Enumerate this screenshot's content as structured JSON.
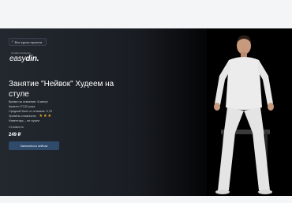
{
  "header": {
    "back_label": "Все курсы проекта"
  },
  "logo": {
    "pretitle": "Онлайн-платформа",
    "part1": "easy",
    "part2": "din."
  },
  "course": {
    "title": "Занятие \"Нейвок\" Худеем на стуле",
    "details": [
      "Время на освоение: 8 минут",
      "Купили 17132 раза",
      "Средний балл от отзывов: 9,78",
      "Уровень сложности:",
      "Инвентарь – не нужен"
    ],
    "difficulty_stars": 3
  },
  "pricing": {
    "label": "Стоимость",
    "price": "249 ₽"
  },
  "actions": {
    "enroll_label": "Записаться сейчас"
  },
  "colors": {
    "background": "#16191e",
    "accent_button": "#2f4a6b",
    "star": "#f2b01e"
  }
}
